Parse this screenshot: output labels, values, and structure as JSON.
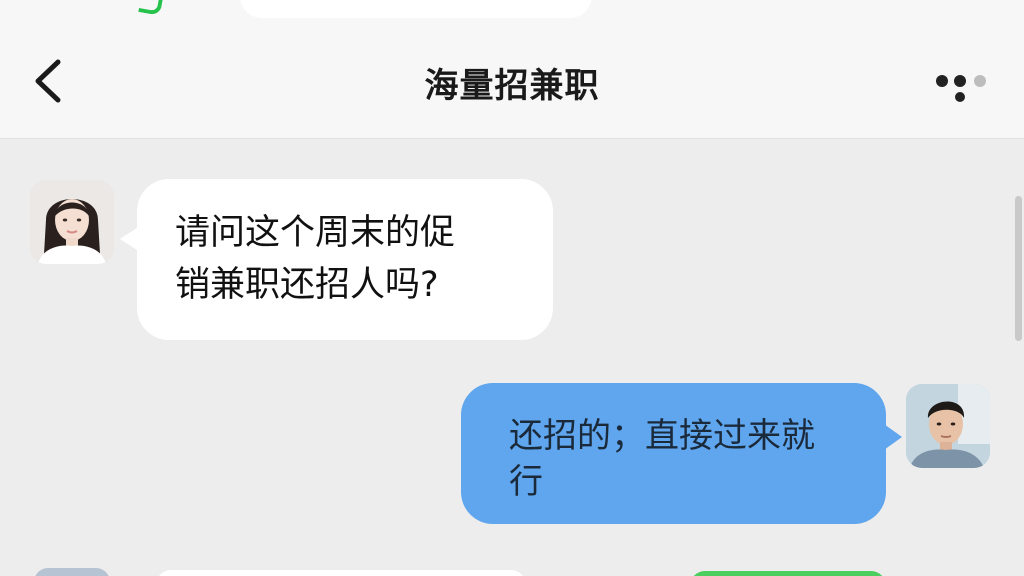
{
  "header": {
    "title": "海量招兼职",
    "back_icon": "chevron-left-icon",
    "more_icon": "more-dots-icon"
  },
  "messages": [
    {
      "direction": "incoming",
      "avatar": "female-avatar",
      "lines": [
        "请问这个周末的促",
        "销兼职还招人吗?"
      ]
    },
    {
      "direction": "outgoing",
      "avatar": "male-avatar",
      "lines": [
        "还招的；直接过来就",
        "行"
      ]
    }
  ],
  "colors": {
    "background": "#ededed",
    "header_bg": "#f7f7f7",
    "incoming_bubble": "#ffffff",
    "outgoing_bubble": "#5fa6ee",
    "peek_green": "#4ccf5f"
  }
}
